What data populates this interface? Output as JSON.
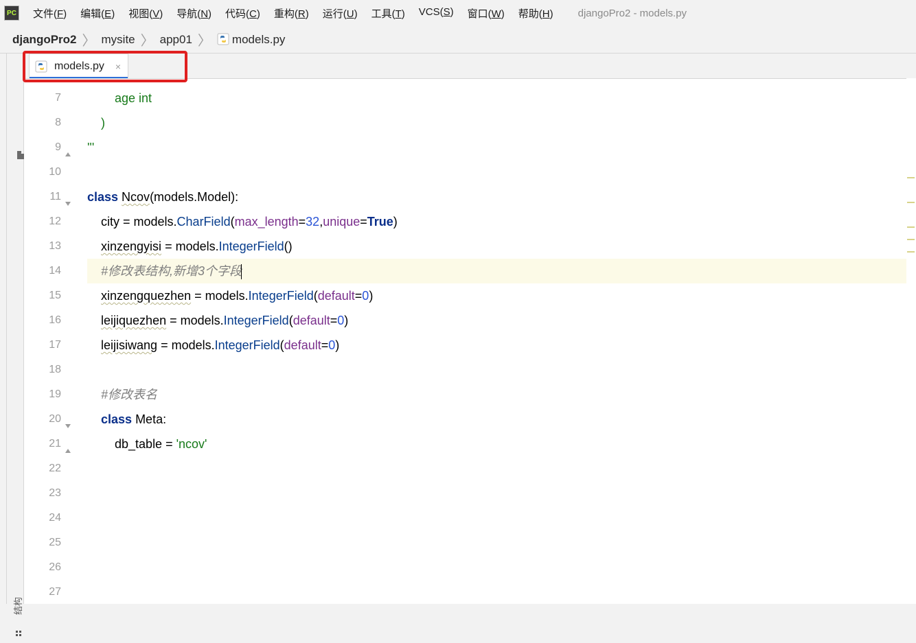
{
  "menubar": {
    "items": [
      {
        "label": "文件",
        "mnemonic": "F"
      },
      {
        "label": "编辑",
        "mnemonic": "E"
      },
      {
        "label": "视图",
        "mnemonic": "V"
      },
      {
        "label": "导航",
        "mnemonic": "N"
      },
      {
        "label": "代码",
        "mnemonic": "C"
      },
      {
        "label": "重构",
        "mnemonic": "R"
      },
      {
        "label": "运行",
        "mnemonic": "U"
      },
      {
        "label": "工具",
        "mnemonic": "T"
      },
      {
        "label": "VCS",
        "mnemonic": "S"
      },
      {
        "label": "窗口",
        "mnemonic": "W"
      },
      {
        "label": "帮助",
        "mnemonic": "H"
      }
    ],
    "window_title": "djangoPro2 - models.py"
  },
  "breadcrumb": {
    "items": [
      {
        "label": "djangoPro2",
        "bold": true
      },
      {
        "label": "mysite"
      },
      {
        "label": "app01"
      },
      {
        "label": "models.py",
        "icon": "python"
      }
    ]
  },
  "tab": {
    "label": "models.py"
  },
  "left_tool_label": "结构",
  "gutter": {
    "start": 7,
    "end": 27
  },
  "code_lines": [
    {
      "n": 7,
      "indent": 8,
      "tokens": [
        {
          "t": "age int",
          "c": "str"
        }
      ]
    },
    {
      "n": 8,
      "indent": 4,
      "tokens": [
        {
          "t": ")",
          "c": "str"
        }
      ]
    },
    {
      "n": 9,
      "indent": 0,
      "fold": "end",
      "tokens": [
        {
          "t": "'''",
          "c": "str"
        }
      ]
    },
    {
      "n": 10,
      "indent": 0,
      "tokens": []
    },
    {
      "n": 11,
      "indent": 0,
      "fold": "start",
      "tokens": [
        {
          "t": "class ",
          "c": "kw"
        },
        {
          "t": "Ncov",
          "c": "wavy"
        },
        {
          "t": "(models.Model):"
        }
      ]
    },
    {
      "n": 12,
      "indent": 4,
      "tokens": [
        {
          "t": "city = models."
        },
        {
          "t": "CharField",
          "c": "fn"
        },
        {
          "t": "("
        },
        {
          "t": "max_length",
          "c": "param"
        },
        {
          "t": "="
        },
        {
          "t": "32",
          "c": "num"
        },
        {
          "t": ","
        },
        {
          "t": "unique",
          "c": "param"
        },
        {
          "t": "="
        },
        {
          "t": "True",
          "c": "bool"
        },
        {
          "t": ")"
        }
      ]
    },
    {
      "n": 13,
      "indent": 4,
      "tokens": [
        {
          "t": "xinzengyisi",
          "c": "wavy"
        },
        {
          "t": " = models."
        },
        {
          "t": "IntegerField",
          "c": "fn"
        },
        {
          "t": "()"
        }
      ]
    },
    {
      "n": 14,
      "indent": 4,
      "hl": true,
      "caret": true,
      "tokens": [
        {
          "t": "#修改表结构,新增3个字段",
          "c": "comment"
        }
      ]
    },
    {
      "n": 15,
      "indent": 4,
      "tokens": [
        {
          "t": "xinzengquezhen",
          "c": "wavy"
        },
        {
          "t": " = models."
        },
        {
          "t": "IntegerField",
          "c": "fn"
        },
        {
          "t": "("
        },
        {
          "t": "default",
          "c": "param"
        },
        {
          "t": "="
        },
        {
          "t": "0",
          "c": "num"
        },
        {
          "t": ")"
        }
      ]
    },
    {
      "n": 16,
      "indent": 4,
      "tokens": [
        {
          "t": "leijiquezhen",
          "c": "wavy"
        },
        {
          "t": " = models."
        },
        {
          "t": "IntegerField",
          "c": "fn"
        },
        {
          "t": "("
        },
        {
          "t": "default",
          "c": "param"
        },
        {
          "t": "="
        },
        {
          "t": "0",
          "c": "num"
        },
        {
          "t": ")"
        }
      ]
    },
    {
      "n": 17,
      "indent": 4,
      "tokens": [
        {
          "t": "leijisiwang",
          "c": "wavy"
        },
        {
          "t": " = models."
        },
        {
          "t": "IntegerField",
          "c": "fn"
        },
        {
          "t": "("
        },
        {
          "t": "default",
          "c": "param"
        },
        {
          "t": "="
        },
        {
          "t": "0",
          "c": "num"
        },
        {
          "t": ")"
        }
      ]
    },
    {
      "n": 18,
      "indent": 0,
      "tokens": []
    },
    {
      "n": 19,
      "indent": 4,
      "tokens": [
        {
          "t": "#修改表名",
          "c": "comment"
        }
      ]
    },
    {
      "n": 20,
      "indent": 4,
      "fold": "start",
      "tokens": [
        {
          "t": "class ",
          "c": "kw"
        },
        {
          "t": "Meta:"
        }
      ]
    },
    {
      "n": 21,
      "indent": 8,
      "fold": "end",
      "tokens": [
        {
          "t": "db_table = "
        },
        {
          "t": "'ncov'",
          "c": "str"
        }
      ]
    },
    {
      "n": 22,
      "indent": 0,
      "tokens": []
    },
    {
      "n": 23,
      "indent": 0,
      "tokens": []
    },
    {
      "n": 24,
      "indent": 0,
      "tokens": []
    },
    {
      "n": 25,
      "indent": 0,
      "tokens": []
    },
    {
      "n": 26,
      "indent": 0,
      "tokens": []
    },
    {
      "n": 27,
      "indent": 0,
      "tokens": []
    }
  ]
}
